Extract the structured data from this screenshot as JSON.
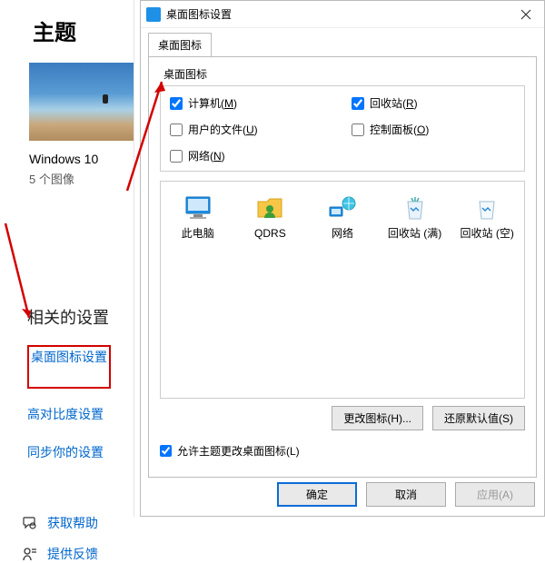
{
  "settings": {
    "title": "主题",
    "theme_name": "Windows 10",
    "theme_count": "5 个图像",
    "related_header": "相关的设置",
    "links": {
      "desktop_icon_settings": "桌面图标设置",
      "high_contrast": "高对比度设置",
      "sync": "同步你的设置"
    },
    "help": "获取帮助",
    "feedback": "提供反馈"
  },
  "dialog": {
    "title": "桌面图标设置",
    "tab": "桌面图标",
    "group_label": "桌面图标",
    "checkboxes": {
      "computer": {
        "label_pre": "计算机(",
        "key": "M",
        "label_post": ")",
        "checked": true
      },
      "recycle": {
        "label_pre": "回收站(",
        "key": "R",
        "label_post": ")",
        "checked": true
      },
      "userfiles": {
        "label_pre": "用户的文件(",
        "key": "U",
        "label_post": ")",
        "checked": false
      },
      "control": {
        "label_pre": "控制面板(",
        "key": "O",
        "label_post": ")",
        "checked": false
      },
      "network": {
        "label_pre": "网络(",
        "key": "N",
        "label_post": ")",
        "checked": false
      }
    },
    "icons": {
      "thispc": "此电脑",
      "user": "QDRS",
      "network": "网络",
      "recycle_full": "回收站 (满)",
      "recycle_empty": "回收站 (空)"
    },
    "change_icon_btn": "更改图标(H)...",
    "restore_btn": "还原默认值(S)",
    "allow_themes": "允许主题更改桌面图标(L)",
    "ok": "确定",
    "cancel": "取消",
    "apply": "应用(A)"
  }
}
